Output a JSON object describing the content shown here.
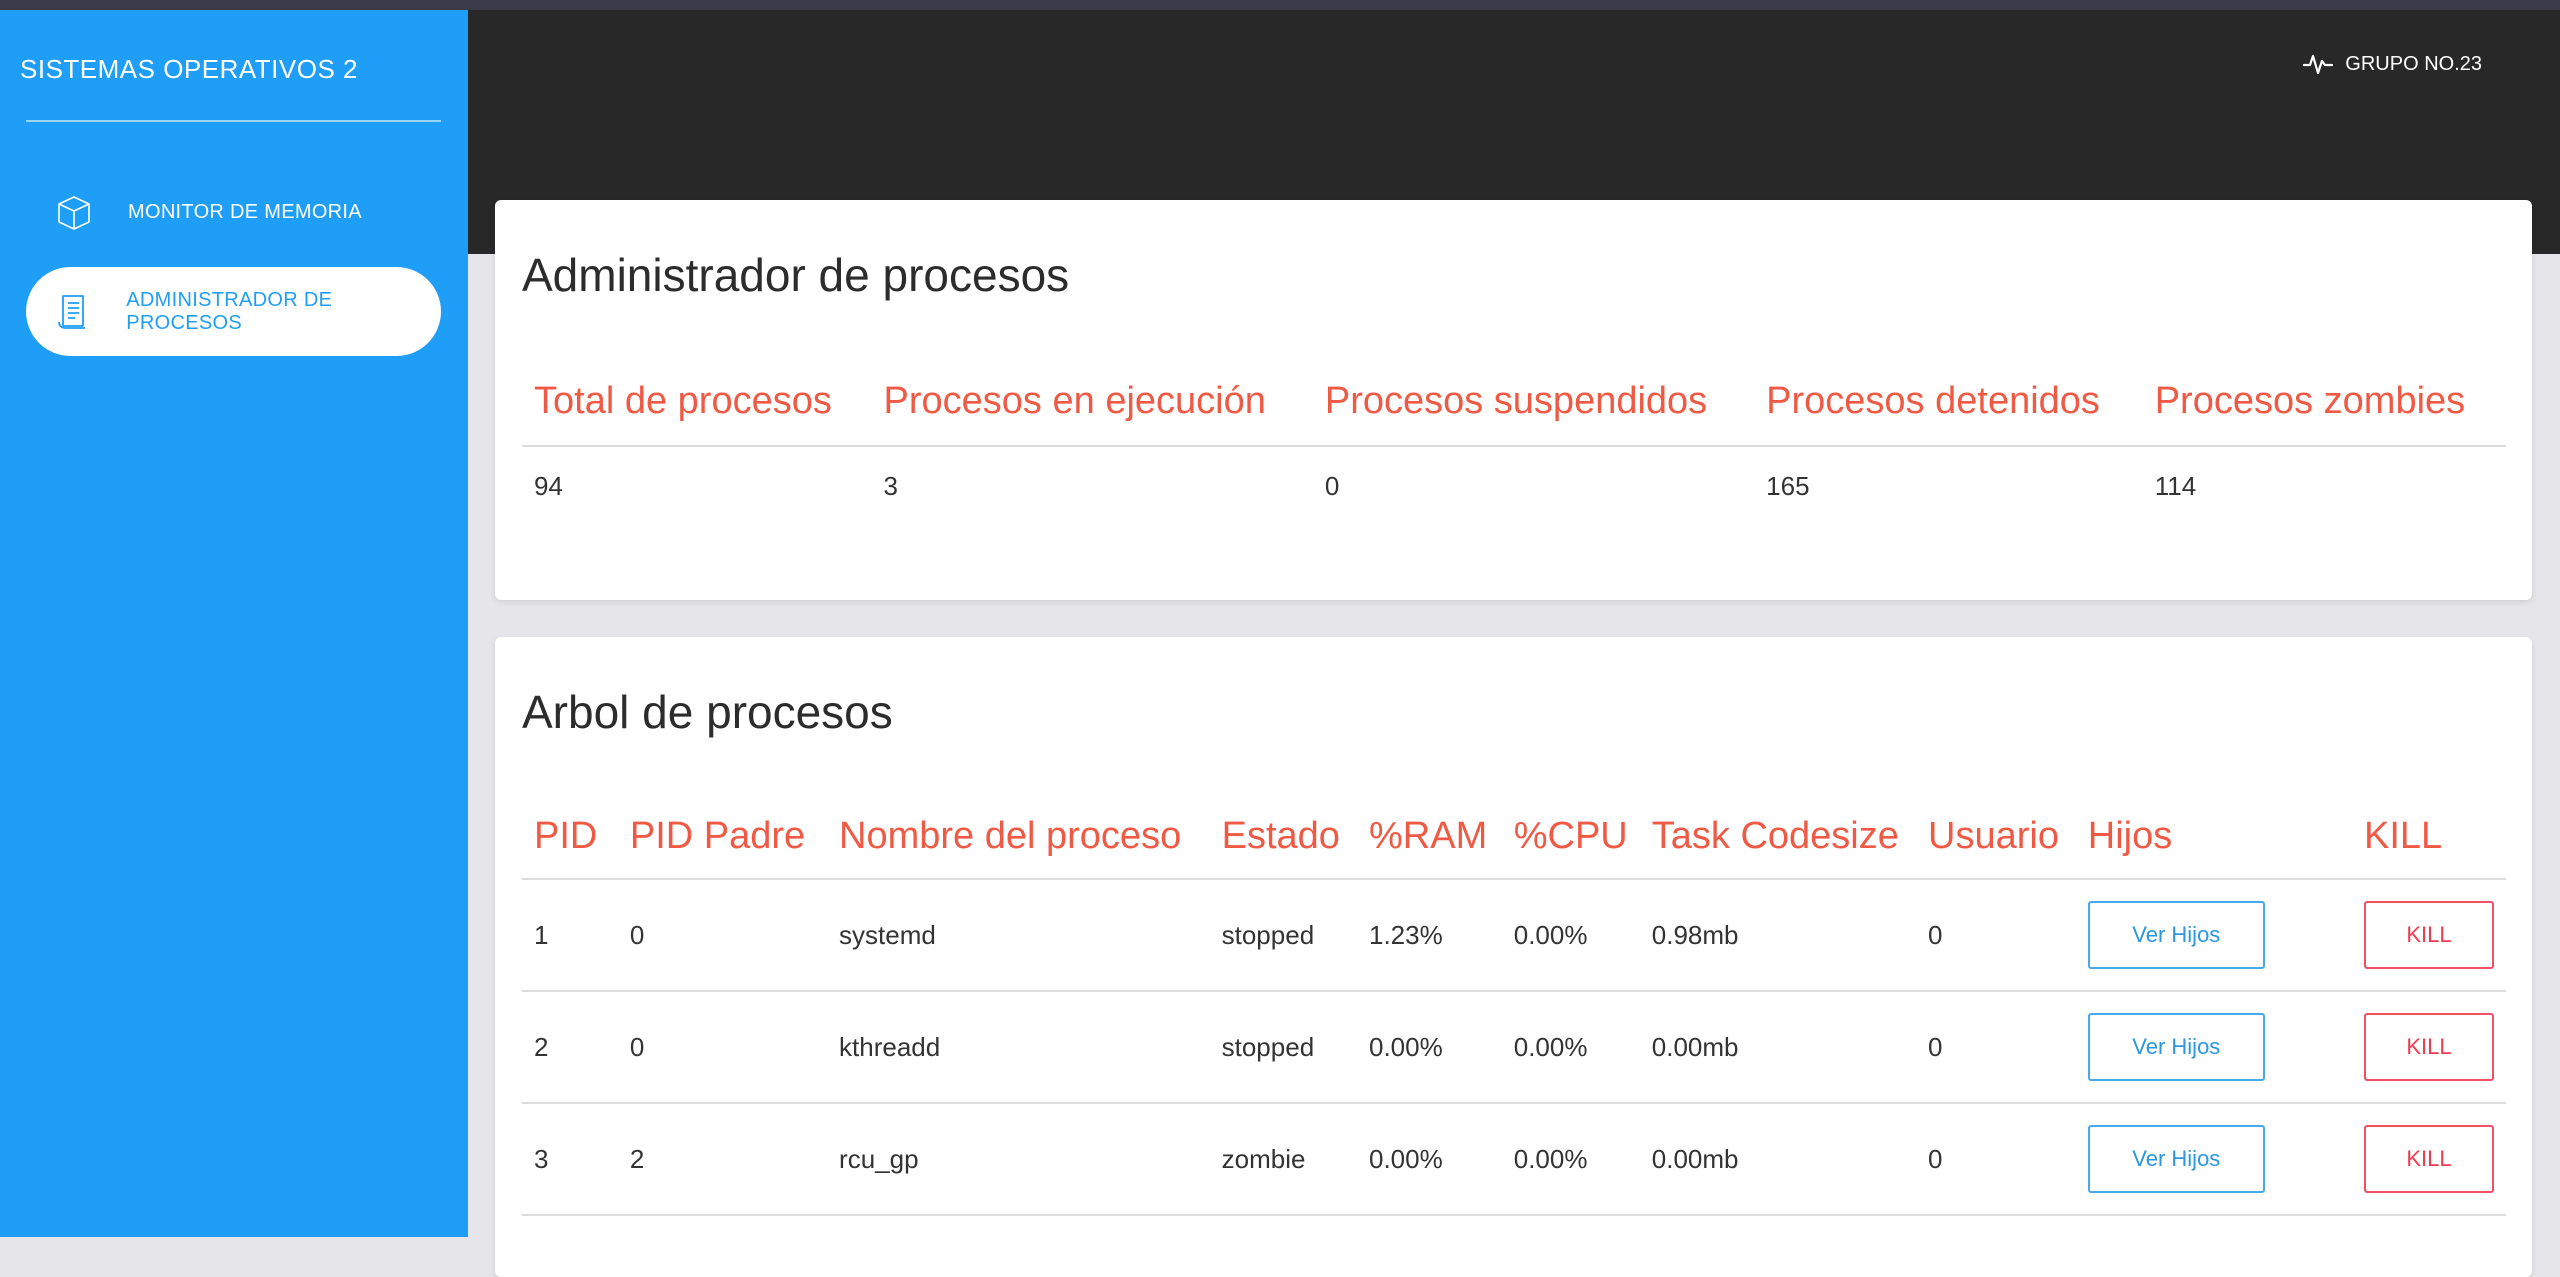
{
  "sidebar": {
    "brand": "SISTEMAS OPERATIVOS 2",
    "items": [
      {
        "label": "MONITOR DE MEMORIA",
        "icon": "cube-icon",
        "active": false
      },
      {
        "label": "ADMINISTRADOR DE PROCESOS",
        "icon": "document-icon",
        "active": true
      }
    ]
  },
  "header": {
    "group_label": "GRUPO NO.23",
    "group_icon": "pulse-icon"
  },
  "summary": {
    "title": "Administrador de procesos",
    "headers": [
      "Total de procesos",
      "Procesos en ejecución",
      "Procesos suspendidos",
      "Procesos detenidos",
      "Procesos zombies"
    ],
    "values": [
      "94",
      "3",
      "0",
      "165",
      "114"
    ]
  },
  "tree": {
    "title": "Arbol de procesos",
    "headers": [
      "PID",
      "PID Padre",
      "Nombre del proceso",
      "Estado",
      "%RAM",
      "%CPU",
      "Task Codesize",
      "Usuario",
      "Hijos",
      "KILL"
    ],
    "rows": [
      {
        "pid": "1",
        "ppid": "0",
        "name": "systemd",
        "state": "stopped",
        "ram": "1.23%",
        "cpu": "0.00%",
        "codesize": "0.98mb",
        "user": "0",
        "hijos_label": "Ver Hijos",
        "kill_label": "KILL"
      },
      {
        "pid": "2",
        "ppid": "0",
        "name": "kthreadd",
        "state": "stopped",
        "ram": "0.00%",
        "cpu": "0.00%",
        "codesize": "0.00mb",
        "user": "0",
        "hijos_label": "Ver Hijos",
        "kill_label": "KILL"
      },
      {
        "pid": "3",
        "ppid": "2",
        "name": "rcu_gp",
        "state": "zombie",
        "ram": "0.00%",
        "cpu": "0.00%",
        "codesize": "0.00mb",
        "user": "0",
        "hijos_label": "Ver Hijos",
        "kill_label": "KILL"
      }
    ]
  },
  "colors": {
    "sidebar": "#1f9ef7",
    "header": "#282828",
    "heading_accent": "#f05a45",
    "info_button": "#2b97e2",
    "danger_button": "#ef3a50"
  }
}
